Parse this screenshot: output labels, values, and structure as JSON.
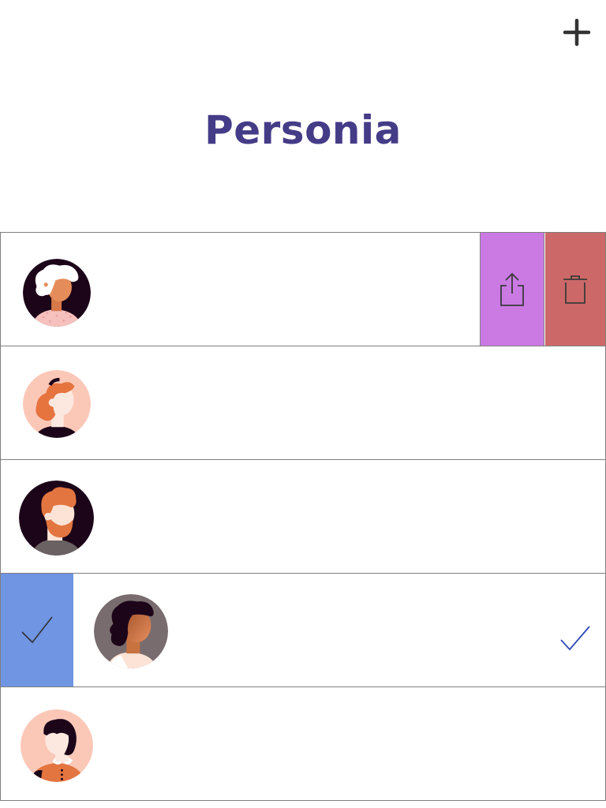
{
  "app": {
    "title": "Personia"
  },
  "toolbar": {
    "add_icon": "plus-icon"
  },
  "colors": {
    "title": "#443c87",
    "share_action": "#cb7ae4",
    "delete_action": "#cd6868",
    "select_action": "#6f95e3",
    "checkmark": "#2f49b8",
    "row_border": "#7f7f7f"
  },
  "rows": [
    {
      "avatar": "woman-white-curly-hair-avatar",
      "swipe_actions": [
        "share-icon",
        "trash-icon"
      ],
      "selected": false
    },
    {
      "avatar": "woman-red-curly-hair-headset-avatar",
      "selected": false
    },
    {
      "avatar": "man-red-hair-beard-avatar",
      "selected": false
    },
    {
      "avatar": "woman-dark-curly-hair-avatar",
      "swipe_actions": [
        "checkmark-icon"
      ],
      "selected": true
    },
    {
      "avatar": "woman-dark-hair-orange-top-avatar",
      "selected": false
    }
  ]
}
